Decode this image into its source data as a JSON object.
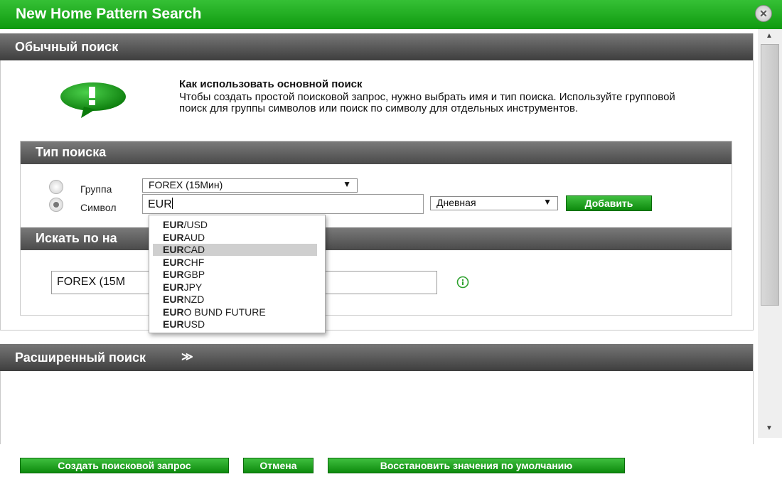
{
  "window": {
    "title": "New Home Pattern Search",
    "close_icon": "close-icon"
  },
  "basic_search": {
    "header": "Обычный поиск",
    "help_icon": "speech-bubble-exclamation-icon",
    "help_title": "Как использовать основной поиск",
    "help_text": "Чтобы создать простой поисковой запрос, нужно выбрать имя и тип поиска. Используйте групповой поиск для группы символов или поиск по символу для отдельных инструментов.",
    "search_type": {
      "header": "Тип поиска",
      "group_label": "Группа",
      "group_select": "FOREX (15Мин)",
      "symbol_label": "Символ",
      "symbol_input": "EUR",
      "timeframe_select": "Дневная",
      "add_button": "Добавить",
      "selected": "symbol"
    },
    "search_by_name": {
      "header": "Искать по на",
      "input_value": "FOREX (15M",
      "info_icon": "info-icon"
    }
  },
  "autocomplete": {
    "query": "EUR",
    "items": [
      {
        "match": "EUR",
        "rest": "/USD"
      },
      {
        "match": "EUR",
        "rest": "AUD"
      },
      {
        "match": "EUR",
        "rest": "CAD"
      },
      {
        "match": "EUR",
        "rest": "CHF"
      },
      {
        "match": "EUR",
        "rest": "GBP"
      },
      {
        "match": "EUR",
        "rest": "JPY"
      },
      {
        "match": "EUR",
        "rest": "NZD"
      },
      {
        "match": "EUR",
        "rest": "O BUND FUTURE"
      },
      {
        "match": "EUR",
        "rest": "USD"
      }
    ],
    "highlighted": "EURCAD"
  },
  "advanced_search": {
    "header": "Расширенный поиск",
    "expand_icon": "double-chevron-down-icon"
  },
  "footer": {
    "create_button": "Создать поисковой запрос",
    "cancel_button": "Отмена",
    "restore_button": "Восстановить значения по умолчанию"
  },
  "colors": {
    "accent_green": "#17a317",
    "header_dark": "#4a4a4a",
    "highlight": "#cfcfcf"
  }
}
